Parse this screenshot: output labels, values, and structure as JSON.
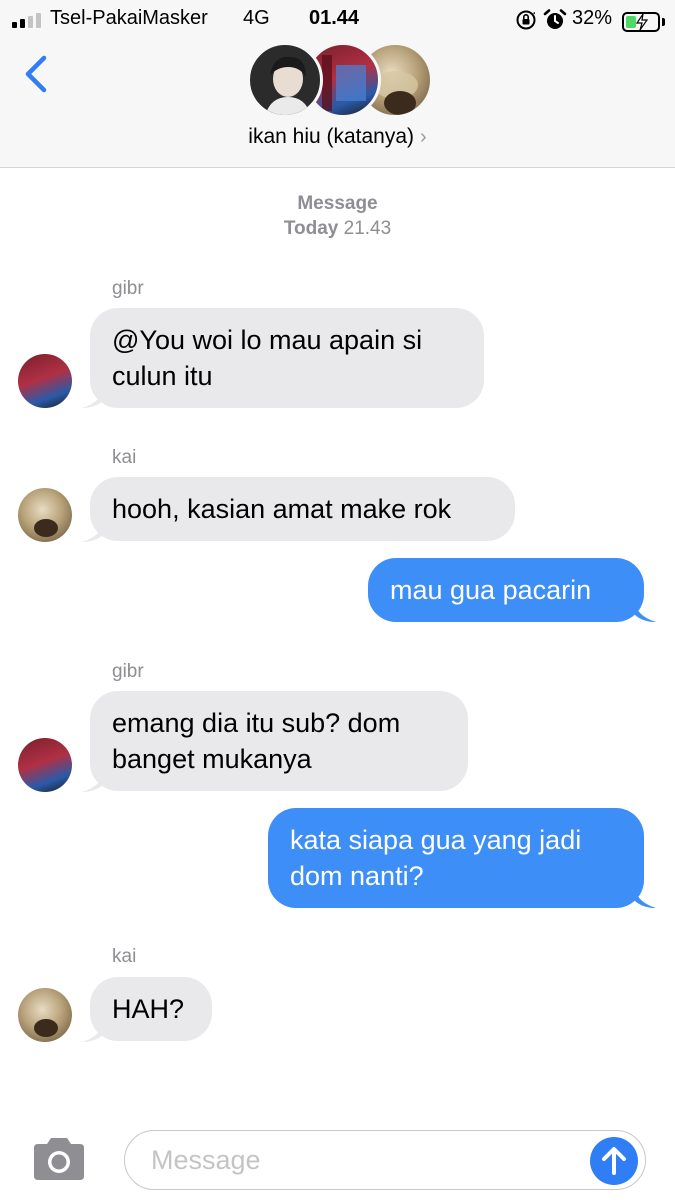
{
  "status_bar": {
    "carrier": "Tsel-PakaiMasker",
    "network": "4G",
    "time": "01.44",
    "battery_percent": "32%",
    "battery_level": 0.32,
    "icons": [
      "orientation-lock-icon",
      "alarm-icon",
      "battery-charging-icon"
    ]
  },
  "header": {
    "back_icon": "chevron-left-icon",
    "group_name": "ikan hiu (katanya)",
    "group_chevron": "›"
  },
  "thread": {
    "service": "Message",
    "day": "Today",
    "time": "21.43",
    "messages": [
      {
        "sender": "gibr",
        "direction": "incoming",
        "text": "@You woi lo mau apain si culun itu"
      },
      {
        "sender": "kai",
        "direction": "incoming",
        "text": "hooh, kasian amat make rok"
      },
      {
        "sender": "",
        "direction": "outgoing",
        "text": "mau gua pacarin"
      },
      {
        "sender": "gibr",
        "direction": "incoming",
        "text": "emang dia itu sub? dom banget mukanya"
      },
      {
        "sender": "",
        "direction": "outgoing",
        "text": "kata siapa gua yang jadi dom nanti?"
      },
      {
        "sender": "kai",
        "direction": "incoming",
        "text": "HAH?"
      }
    ]
  },
  "composer": {
    "placeholder": "Message",
    "camera_icon": "camera-icon",
    "send_icon": "arrow-up-icon"
  },
  "colors": {
    "outgoing_bubble": "#3e8ef7",
    "incoming_bubble": "#e9e9eb",
    "accent": "#2f7ef5"
  }
}
